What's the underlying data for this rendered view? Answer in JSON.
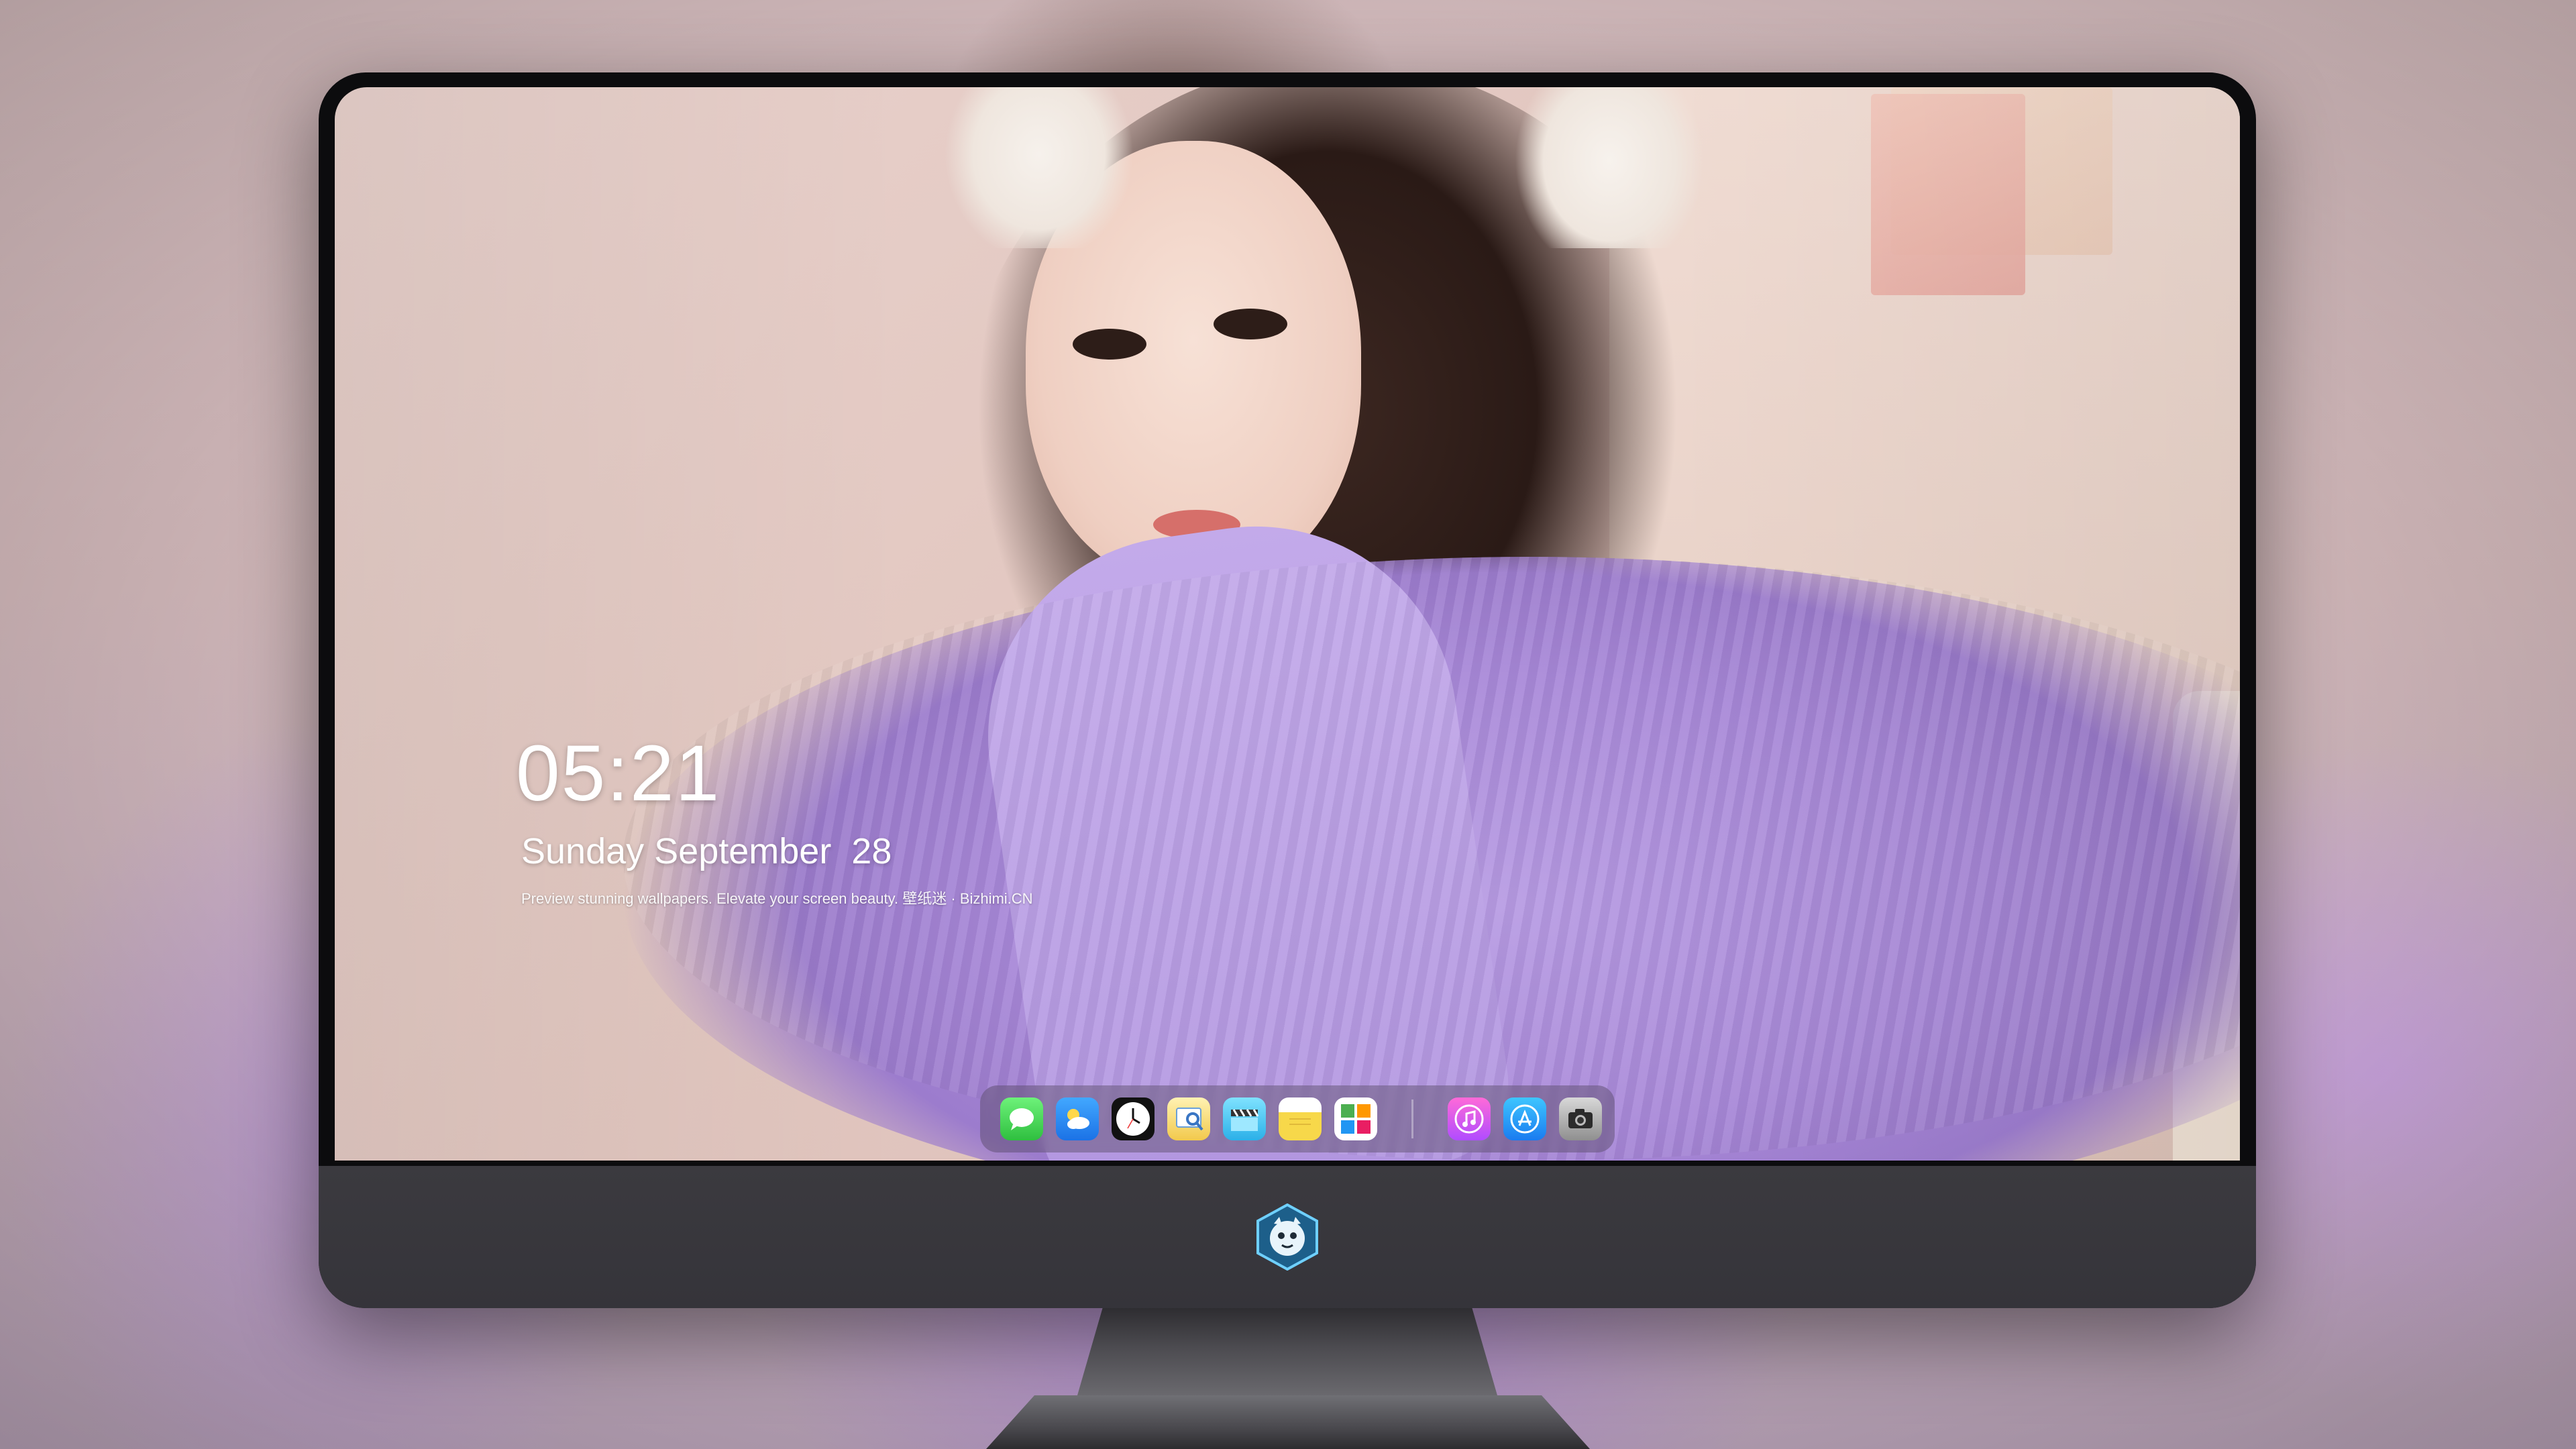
{
  "lockscreen": {
    "time": "05:21",
    "date": "Sunday September  28",
    "tagline": "Preview stunning wallpapers. Elevate your screen beauty. 壁纸迷 · Bizhimi.CN"
  },
  "dock": {
    "apps": [
      {
        "icon": "messages-icon"
      },
      {
        "icon": "weather-icon"
      },
      {
        "icon": "clock-icon"
      },
      {
        "icon": "preview-icon"
      },
      {
        "icon": "clips-icon"
      },
      {
        "icon": "notes-icon"
      },
      {
        "icon": "photos-icon"
      },
      {
        "icon": "music-icon"
      },
      {
        "icon": "app-store-icon"
      },
      {
        "icon": "camera-icon"
      }
    ]
  },
  "monitor": {
    "logo": "bizhimi-mascot-logo"
  },
  "colors": {
    "accent_sweater": "#b79be3",
    "bezel": "#0c0c0e",
    "chin": "#3b3a3f"
  }
}
